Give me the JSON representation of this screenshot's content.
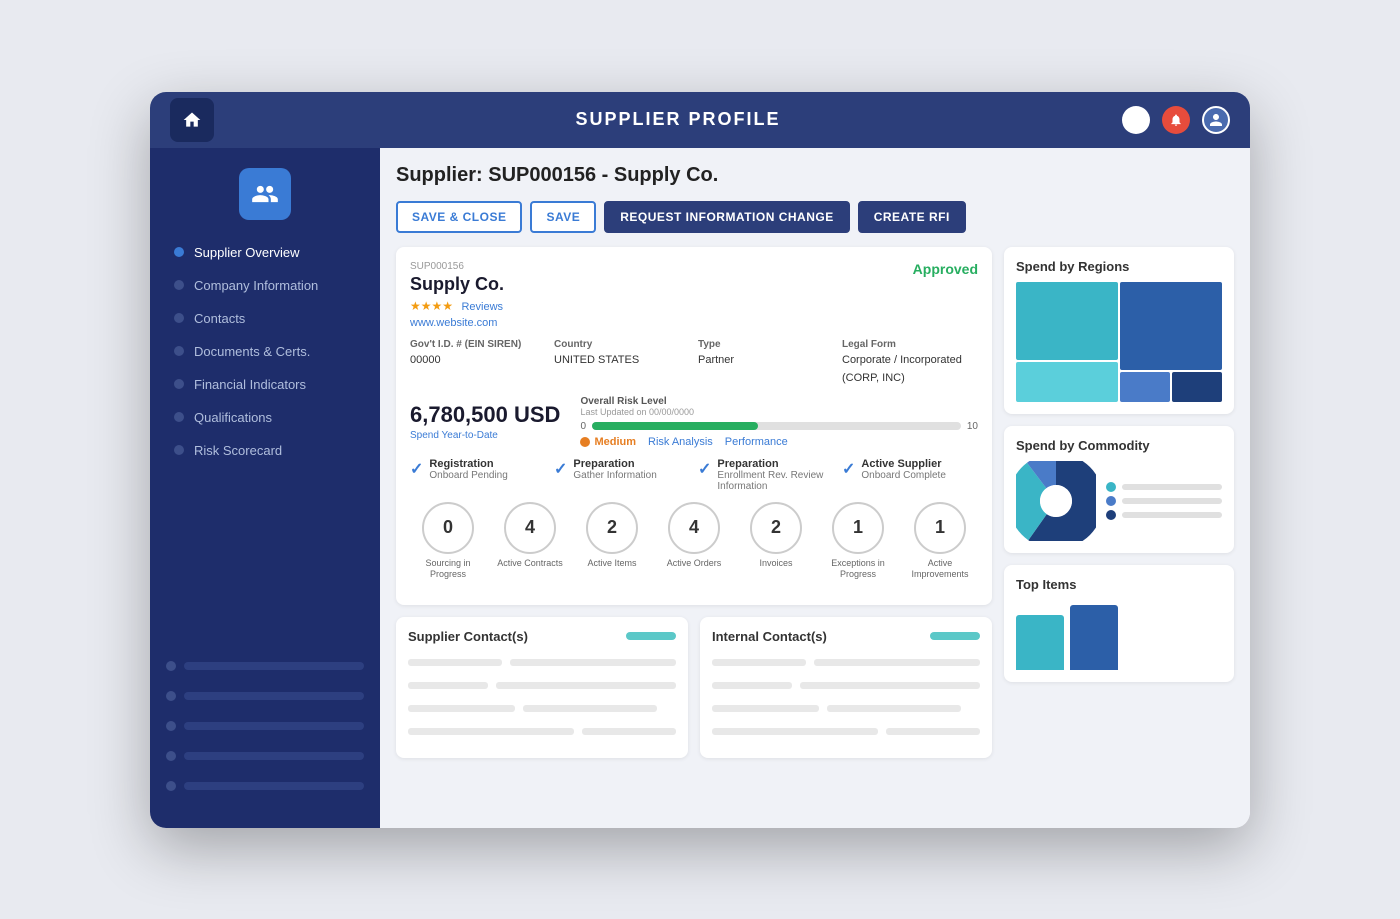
{
  "topbar": {
    "title": "SUPPLIER PROFILE",
    "home_icon": "🏠"
  },
  "sidebar": {
    "nav_items": [
      {
        "label": "Supplier Overview",
        "active": true
      },
      {
        "label": "Company Information",
        "active": false
      },
      {
        "label": "Contacts",
        "active": false
      },
      {
        "label": "Documents & Certs.",
        "active": false
      },
      {
        "label": "Financial Indicators",
        "active": false
      },
      {
        "label": "Qualifications",
        "active": false
      },
      {
        "label": "Risk Scorecard",
        "active": false
      }
    ]
  },
  "page": {
    "supplier_title": "Supplier: SUP000156 - Supply Co.",
    "buttons": {
      "save_close": "SAVE & CLOSE",
      "save": "SAVE",
      "request_info": "REQUEST INFORMATION CHANGE",
      "create_rfi": "CREATE RFI"
    }
  },
  "supplier_card": {
    "id": "SUP000156",
    "name": "Supply Co.",
    "stars": "★★★★",
    "reviews": "Reviews",
    "website": "www.website.com",
    "status": "Approved",
    "gov_id_label": "Gov't I.D. # (EIN SIREN)",
    "gov_id_value": "00000",
    "country_label": "Country",
    "country_value": "UNITED STATES",
    "type_label": "Type",
    "type_value": "Partner",
    "legal_form_label": "Legal Form",
    "legal_form_value": "Corporate / Incorporated (CORP, INC)",
    "spend_amount": "6,780,500 USD",
    "spend_label": "Spend Year-to-Date",
    "risk_label": "Overall Risk Level",
    "risk_updated": "Last Updated on 00/00/0000",
    "risk_min": "0",
    "risk_max": "10",
    "risk_status": "Medium",
    "risk_analysis": "Risk Analysis",
    "performance": "Performance",
    "steps": [
      {
        "title": "Registration",
        "subtitle": "Onboard Pending"
      },
      {
        "title": "Preparation",
        "subtitle": "Gather Information"
      },
      {
        "title": "Preparation",
        "subtitle": "Enrollment Rev. Review Information"
      },
      {
        "title": "Active Supplier",
        "subtitle": "Onboard Complete"
      }
    ],
    "metrics": [
      {
        "value": "0",
        "label": "Sourcing in Progress"
      },
      {
        "value": "4",
        "label": "Active Contracts"
      },
      {
        "value": "2",
        "label": "Active Items"
      },
      {
        "value": "4",
        "label": "Active Orders"
      },
      {
        "value": "2",
        "label": "Invoices"
      },
      {
        "value": "1",
        "label": "Exceptions in Progress"
      },
      {
        "value": "1",
        "label": "Active Improvements"
      }
    ]
  },
  "contacts": {
    "supplier_title": "Supplier Contact(s)",
    "internal_title": "Internal Contact(s)"
  },
  "right_panels": {
    "spend_regions_title": "Spend by Regions",
    "spend_commodity_title": "Spend by Commodity",
    "top_items_title": "Top Items",
    "legend": [
      {
        "color": "#3ab5c6"
      },
      {
        "color": "#4a7bc8"
      },
      {
        "color": "#1e3f7a"
      }
    ]
  }
}
